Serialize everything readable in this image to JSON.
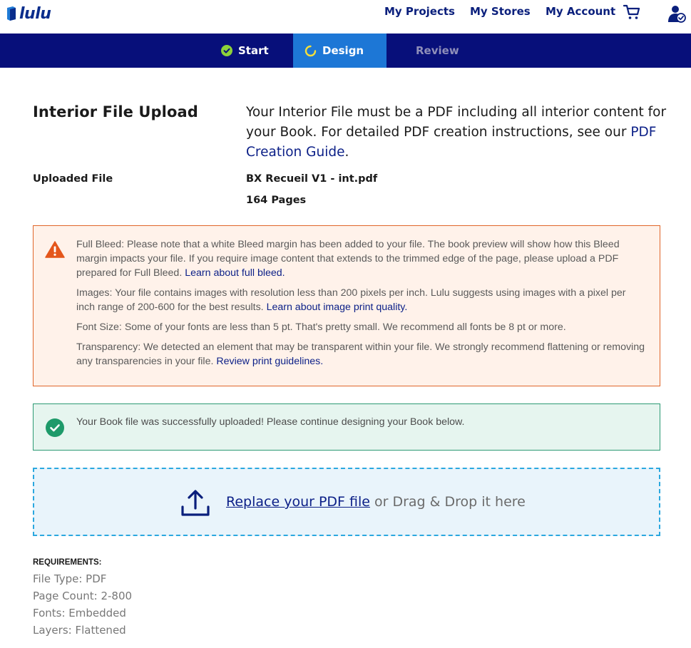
{
  "header": {
    "logo_text": "lulu",
    "nav": [
      {
        "label": "My Projects"
      },
      {
        "label": "My Stores"
      },
      {
        "label": "My Account"
      }
    ],
    "cart_icon": "cart-icon",
    "user_icon": "user-check-icon"
  },
  "stepper": {
    "steps": [
      {
        "label": "Start",
        "state": "complete"
      },
      {
        "label": "Design",
        "state": "active"
      },
      {
        "label": "Review",
        "state": "pending"
      }
    ],
    "colors": {
      "bar": "#070f7a",
      "active": "#1d77d6",
      "complete_icon": "#8dd13a"
    }
  },
  "interior": {
    "title": "Interior File Upload",
    "intro_text": "Your Interior File must be a PDF including all interior content for your Book. For detailed PDF creation instructions, see our ",
    "intro_link": "PDF Creation Guide",
    "intro_end": ".",
    "uploaded_label": "Uploaded File",
    "file_name": "BX Recueil V1 - int.pdf",
    "page_count": "164 Pages"
  },
  "warnings": [
    {
      "text": "Full Bleed: Please note that a white Bleed margin has been added to your file. The book preview will show how this Bleed margin impacts your file. If you require image content that extends to the trimmed edge of the page, please upload a PDF prepared for Full Bleed. ",
      "link": "Learn about full bleed."
    },
    {
      "text": "Images: Your file contains images with resolution less than 200 pixels per inch. Lulu suggests using images with a pixel per inch range of 200-600 for the best results. ",
      "link": "Learn about image print quality."
    },
    {
      "text": "Font Size: Some of your fonts are less than 5 pt. That's pretty small. We recommend all fonts be 8 pt or more.",
      "link": ""
    },
    {
      "text": "Transparency: We detected an element that may be transparent within your file. We strongly recommend flattening or removing any transparencies in your file. ",
      "link": "Review print guidelines."
    }
  ],
  "success": {
    "message": "Your Book file was successfully uploaded! Please continue designing your Book below."
  },
  "dropzone": {
    "link_text": "Replace your PDF file",
    "suffix_text": " or Drag & Drop it here"
  },
  "requirements": {
    "heading": "REQUIREMENTS:",
    "items": [
      "File Type: PDF",
      "Page Count: 2-800",
      "Fonts: Embedded",
      "Layers: Flattened"
    ]
  }
}
